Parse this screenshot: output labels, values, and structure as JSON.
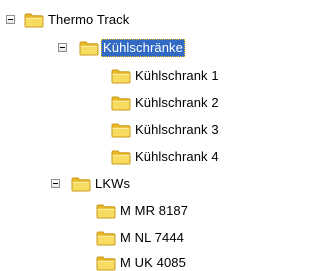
{
  "tree": {
    "root": {
      "label": "Thermo Track",
      "icon": "folder-icon",
      "expanded": true
    },
    "groups": [
      {
        "label": "Kühlschränke",
        "icon": "folder-icon",
        "expanded": true,
        "selected": true,
        "items": [
          {
            "label": "Kühlschrank 1",
            "icon": "folder-icon"
          },
          {
            "label": "Kühlschrank 2",
            "icon": "folder-icon"
          },
          {
            "label": "Kühlschrank 3",
            "icon": "folder-icon"
          },
          {
            "label": "Kühlschrank 4",
            "icon": "folder-icon"
          }
        ]
      },
      {
        "label": "LKWs",
        "icon": "folder-icon",
        "expanded": true,
        "selected": false,
        "items": [
          {
            "label": "M MR 8187",
            "icon": "folder-icon"
          },
          {
            "label": "M NL 7444",
            "icon": "folder-icon"
          },
          {
            "label": "M UK 4085",
            "icon": "folder-icon"
          }
        ]
      }
    ]
  },
  "colors": {
    "selection": "#316ac5",
    "folder": "#f5d44f",
    "folder_outline": "#c99a19"
  }
}
